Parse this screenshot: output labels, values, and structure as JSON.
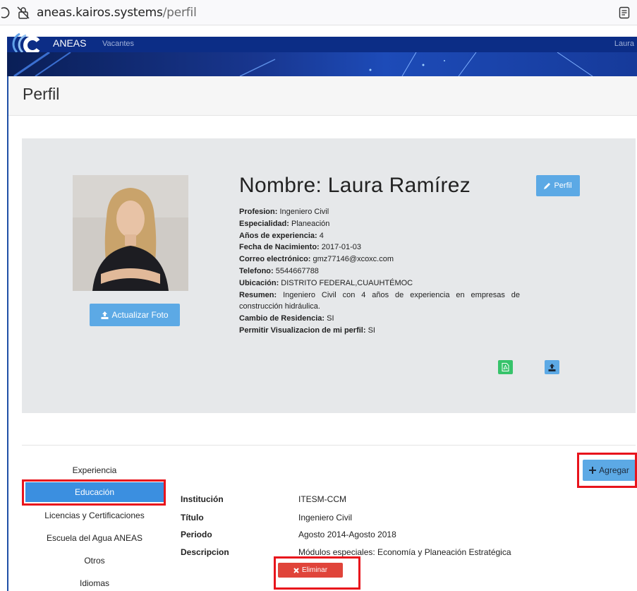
{
  "browser": {
    "url_domain": "aneas.kairos.systems",
    "url_path": "/perfil"
  },
  "navbar": {
    "brand": "ANEAS",
    "link_vacantes": "Vacantes",
    "user": "Laura"
  },
  "page": {
    "title": "Perfil"
  },
  "profile": {
    "name_title": "Nombre: Laura Ramírez",
    "photo_button": "Actualizar Foto",
    "perfil_button": "Perfil",
    "fields": [
      {
        "label": "Profesion:",
        "value": "Ingeniero Civil"
      },
      {
        "label": "Especialidad:",
        "value": "Planeación"
      },
      {
        "label": "Años de experiencia:",
        "value": "4"
      },
      {
        "label": "Fecha de Nacimiento:",
        "value": "2017-01-03"
      },
      {
        "label": "Correo electrónico:",
        "value": "gmz77146@xcoxc.com"
      },
      {
        "label": "Telefono:",
        "value": "5544667788"
      },
      {
        "label": "Ubicación:",
        "value": "DISTRITO FEDERAL,CUAUHTÉMOC"
      },
      {
        "label": "Resumen:",
        "value": "Ingeniero Civil con 4 años de experiencia en empresas de construcción hidráulica."
      },
      {
        "label": "Cambio de Residencia:",
        "value": "SI"
      },
      {
        "label": "Permitir Visualizacion de mi perfil:",
        "value": "SI"
      }
    ]
  },
  "tabs": [
    {
      "label": "Experiencia"
    },
    {
      "label": "Educación"
    },
    {
      "label": "Licencias y Certificaciones"
    },
    {
      "label": "Escuela del Agua ANEAS"
    },
    {
      "label": "Otros"
    },
    {
      "label": "Idiomas"
    }
  ],
  "education": {
    "add_button": "Agregar",
    "delete_button": "Eliminar",
    "rows": [
      {
        "label": "Institución",
        "value": "ITESM-CCM"
      },
      {
        "label": "Título",
        "value": "Ingeniero Civil"
      },
      {
        "label": "Periodo",
        "value": "Agosto 2014-Agosto 2018"
      },
      {
        "label": "Descripcion",
        "value": "Módulos especiales: Economía y Planeación Estratégica"
      }
    ]
  },
  "colors": {
    "navbar": "#0c2d86",
    "button_blue": "#5ca9e5",
    "button_green": "#37c36b",
    "button_red": "#e0443a",
    "tab_active": "#3b8fe0",
    "highlight_red": "#e8141c"
  },
  "icons": [
    "refresh-icon",
    "lock-icon",
    "reader-view-icon",
    "aneas-logo",
    "upload-icon",
    "pencil-icon",
    "pdf-icon",
    "plus-icon",
    "times-icon"
  ]
}
